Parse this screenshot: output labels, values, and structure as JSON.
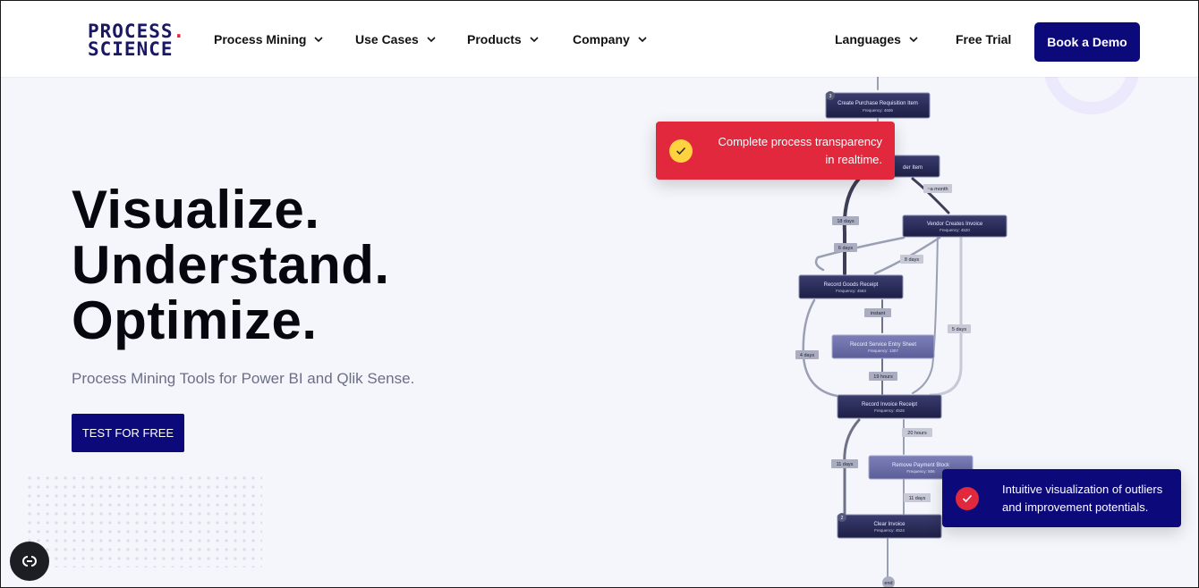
{
  "header": {
    "logo": {
      "line1": "PROCESS",
      "line1_dot": ".",
      "line2": "SCIENCE"
    },
    "nav": [
      {
        "label": "Process Mining",
        "has_dropdown": true
      },
      {
        "label": "Use Cases",
        "has_dropdown": true
      },
      {
        "label": "Products",
        "has_dropdown": true
      },
      {
        "label": "Company",
        "has_dropdown": true
      }
    ],
    "languages": {
      "label": "Languages",
      "has_dropdown": true
    },
    "free_trial": "Free Trial",
    "book_demo": "Book a Demo"
  },
  "hero": {
    "title_lines": [
      "Visualize.",
      "Understand.",
      "Optimize."
    ],
    "subtitle": "Process Mining Tools for Power BI and Qlik Sense.",
    "cta": "TEST FOR FREE"
  },
  "toasts": [
    {
      "text_line1": "Complete process transparency",
      "text_line2": "in realtime.",
      "icon": "check-icon"
    },
    {
      "text_line1": "Intuitive visualization of outliers",
      "text_line2": "and improvement potentials.",
      "icon": "check-icon"
    }
  ],
  "process_map": {
    "nodes": [
      {
        "label": "Create Purchase Requisition Item",
        "freq": "Frequency: 4606",
        "badge": "3"
      },
      {
        "label": "...der Item",
        "freq": ""
      },
      {
        "label": "Vendor Creates Invoice",
        "freq": "Frequency: 4520"
      },
      {
        "label": "Record Goods Receipt",
        "freq": "Frequency: 4563"
      },
      {
        "label": "Record Service Entry Sheet",
        "freq": "Frequency: 1307"
      },
      {
        "label": "Record Invoice Receipt",
        "freq": "Frequency: 4526"
      },
      {
        "label": "Remove Payment Block",
        "freq": "Frequency: 506"
      },
      {
        "label": "Clear Invoice",
        "freq": "Frequency: 4524",
        "badge": "2"
      }
    ],
    "edge_labels": [
      "18 days",
      "6 days",
      "8 days",
      "~a month",
      "instant",
      "4 days",
      "5 days",
      "19 hours",
      "20 hours",
      "11 days",
      "11 days",
      "end"
    ]
  },
  "colors": {
    "brand": "#0c0a7a",
    "accent": "#e1283d",
    "yellow": "#ffd23f"
  }
}
